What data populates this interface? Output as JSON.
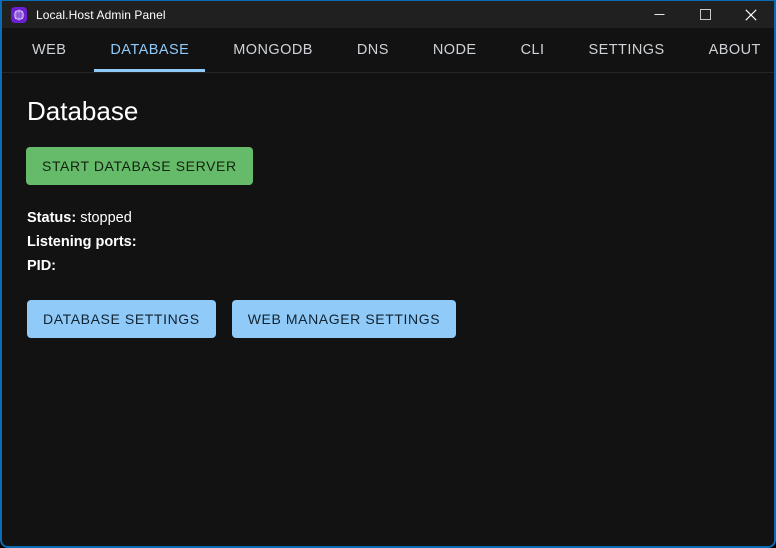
{
  "window": {
    "title": "Local.Host Admin Panel",
    "icon": "globe-icon",
    "controls": {
      "minimize": "minimize-icon",
      "maximize": "maximize-icon",
      "close": "close-icon"
    },
    "border_color": "#0b6cb8"
  },
  "tabs": [
    {
      "label": "WEB",
      "active": false
    },
    {
      "label": "DATABASE",
      "active": true
    },
    {
      "label": "MONGODB",
      "active": false
    },
    {
      "label": "DNS",
      "active": false
    },
    {
      "label": "NODE",
      "active": false
    },
    {
      "label": "CLI",
      "active": false
    },
    {
      "label": "SETTINGS",
      "active": false
    },
    {
      "label": "ABOUT",
      "active": false
    }
  ],
  "main": {
    "page_title": "Database",
    "primary_action": {
      "label": "START DATABASE SERVER",
      "color": "#66bb6a"
    },
    "status": {
      "status_label": "Status:",
      "status_value": "stopped",
      "ports_label": "Listening ports:",
      "ports_value": "",
      "pid_label": "PID:",
      "pid_value": ""
    },
    "settings_buttons": [
      {
        "label": "DATABASE SETTINGS",
        "color": "#90caf9"
      },
      {
        "label": "WEB MANAGER SETTINGS",
        "color": "#90caf9"
      }
    ]
  },
  "theme": {
    "background": "#121212",
    "titlebar": "#202020",
    "accent": "#90caf9",
    "success": "#66bb6a"
  }
}
